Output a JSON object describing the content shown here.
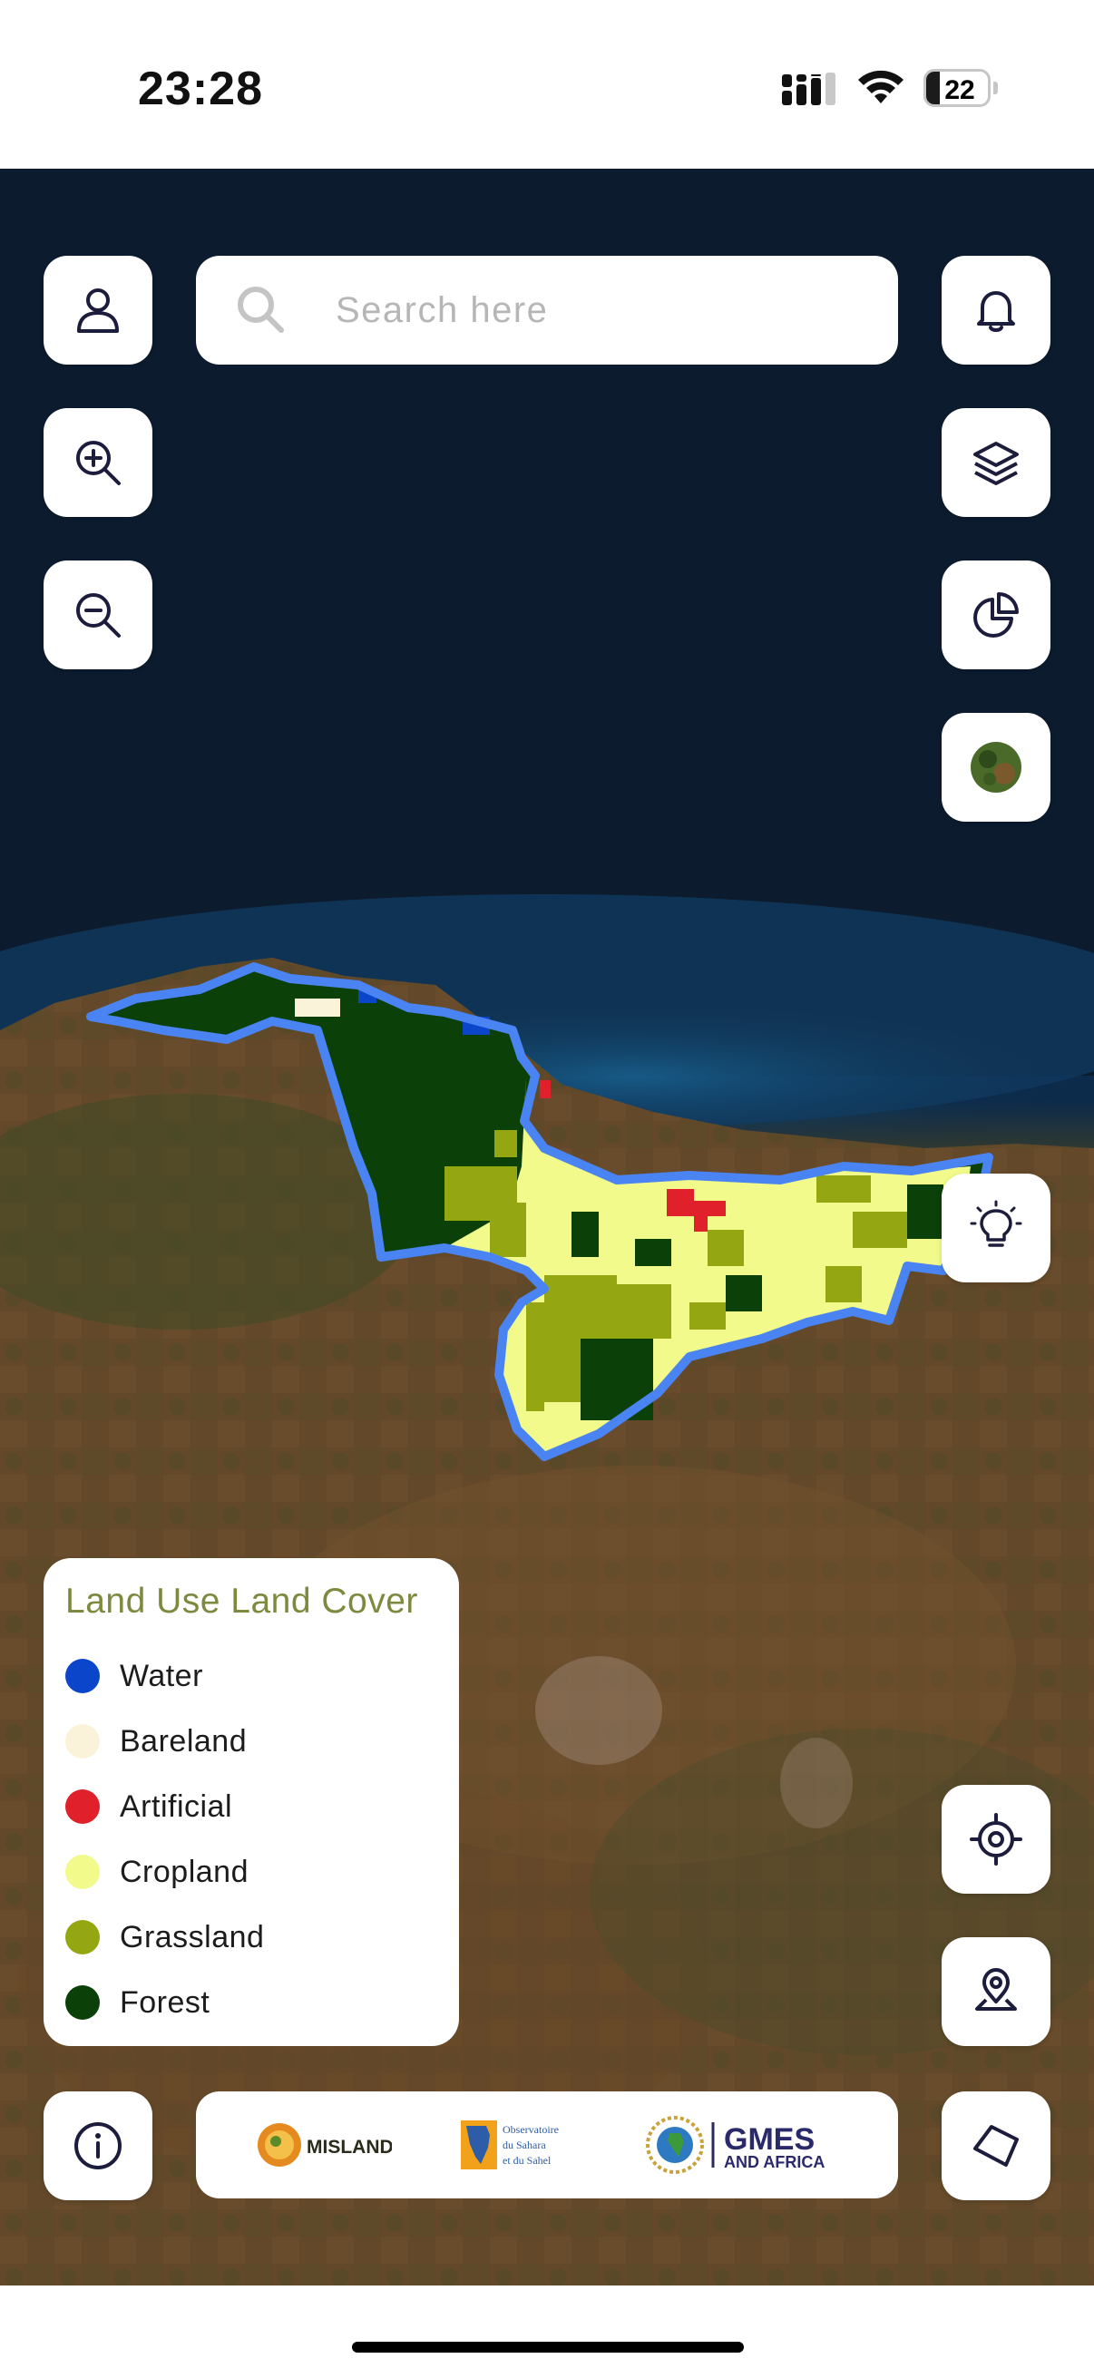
{
  "status_bar": {
    "time": "23:28",
    "battery": "22",
    "battery_level": 0.22,
    "signal_icon": "cellular-signal-icon",
    "wifi_icon": "wifi-icon"
  },
  "search": {
    "placeholder": "Search here",
    "value": ""
  },
  "buttons": {
    "profile": "user-icon",
    "zoom_in": "zoom-in-icon",
    "zoom_out": "zoom-out-icon",
    "notifications": "bell-icon",
    "layers": "layers-icon",
    "statistics": "pie-chart-icon",
    "basemap": "satellite-basemap-icon",
    "insights": "lightbulb-icon",
    "locate": "crosshair-icon",
    "pin": "location-pin-icon",
    "info": "info-icon",
    "draw_polygon": "polygon-icon"
  },
  "legend": {
    "title": "Land Use Land Cover",
    "items": [
      {
        "label": "Water",
        "color": "#0b45c9"
      },
      {
        "label": "Bareland",
        "color": "#fbf3d9"
      },
      {
        "label": "Artificial",
        "color": "#e0202a"
      },
      {
        "label": "Cropland",
        "color": "#f1fa8a"
      },
      {
        "label": "Grassland",
        "color": "#94a712"
      },
      {
        "label": "Forest",
        "color": "#0b4009"
      }
    ]
  },
  "logos": {
    "misland": "MISLAND",
    "oss_line1": "Observatoire",
    "oss_line2": "du Sahara",
    "oss_line3": "et du Sahel",
    "gmes_line1": "GMES",
    "gmes_line2": "AND AFRICA"
  },
  "map": {
    "boundary_color": "#4a84f2"
  }
}
